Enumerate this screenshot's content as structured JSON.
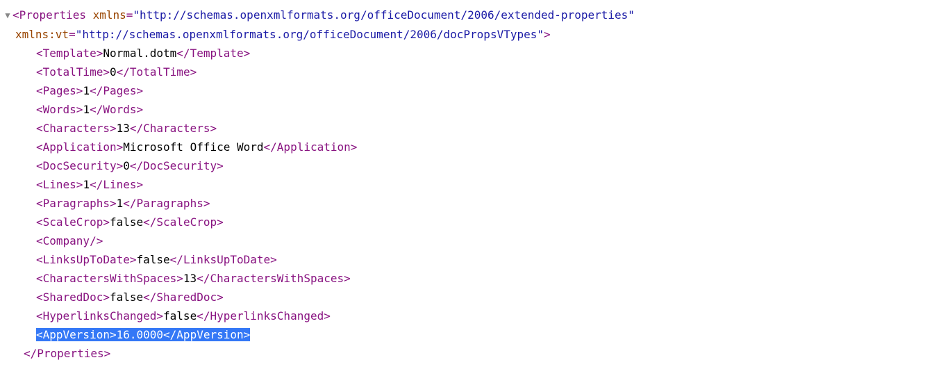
{
  "root": {
    "open_tag_name": "Properties",
    "attrs": [
      {
        "name": "xmlns",
        "value": "\"http://schemas.openxmlformats.org/officeDocument/2006/extended-properties\""
      },
      {
        "name": "xmlns:vt",
        "value": "\"http://schemas.openxmlformats.org/officeDocument/2006/docPropsVTypes\""
      }
    ],
    "close_tag": "</Properties>"
  },
  "rows": [
    {
      "open": "<Template>",
      "text": "Normal.dotm",
      "close": "</Template>"
    },
    {
      "open": "<TotalTime>",
      "text": "0",
      "close": "</TotalTime>"
    },
    {
      "open": "<Pages>",
      "text": "1",
      "close": "</Pages>"
    },
    {
      "open": "<Words>",
      "text": "1",
      "close": "</Words>"
    },
    {
      "open": "<Characters>",
      "text": "13",
      "close": "</Characters>"
    },
    {
      "open": "<Application>",
      "text": "Microsoft Office Word",
      "close": "</Application>"
    },
    {
      "open": "<DocSecurity>",
      "text": "0",
      "close": "</DocSecurity>"
    },
    {
      "open": "<Lines>",
      "text": "1",
      "close": "</Lines>"
    },
    {
      "open": "<Paragraphs>",
      "text": "1",
      "close": "</Paragraphs>"
    },
    {
      "open": "<ScaleCrop>",
      "text": "false",
      "close": "</ScaleCrop>"
    },
    {
      "open": "<Company/>",
      "text": "",
      "close": ""
    },
    {
      "open": "<LinksUpToDate>",
      "text": "false",
      "close": "</LinksUpToDate>"
    },
    {
      "open": "<CharactersWithSpaces>",
      "text": "13",
      "close": "</CharactersWithSpaces>"
    },
    {
      "open": "<SharedDoc>",
      "text": "false",
      "close": "</SharedDoc>"
    },
    {
      "open": "<HyperlinksChanged>",
      "text": "false",
      "close": "</HyperlinksChanged>"
    },
    {
      "open": "<AppVersion>",
      "text": "16.0000",
      "close": "</AppVersion>",
      "highlight": true
    }
  ],
  "glyphs": {
    "collapse": "▼",
    "lt": "<",
    "gt": ">",
    "eq": "="
  }
}
